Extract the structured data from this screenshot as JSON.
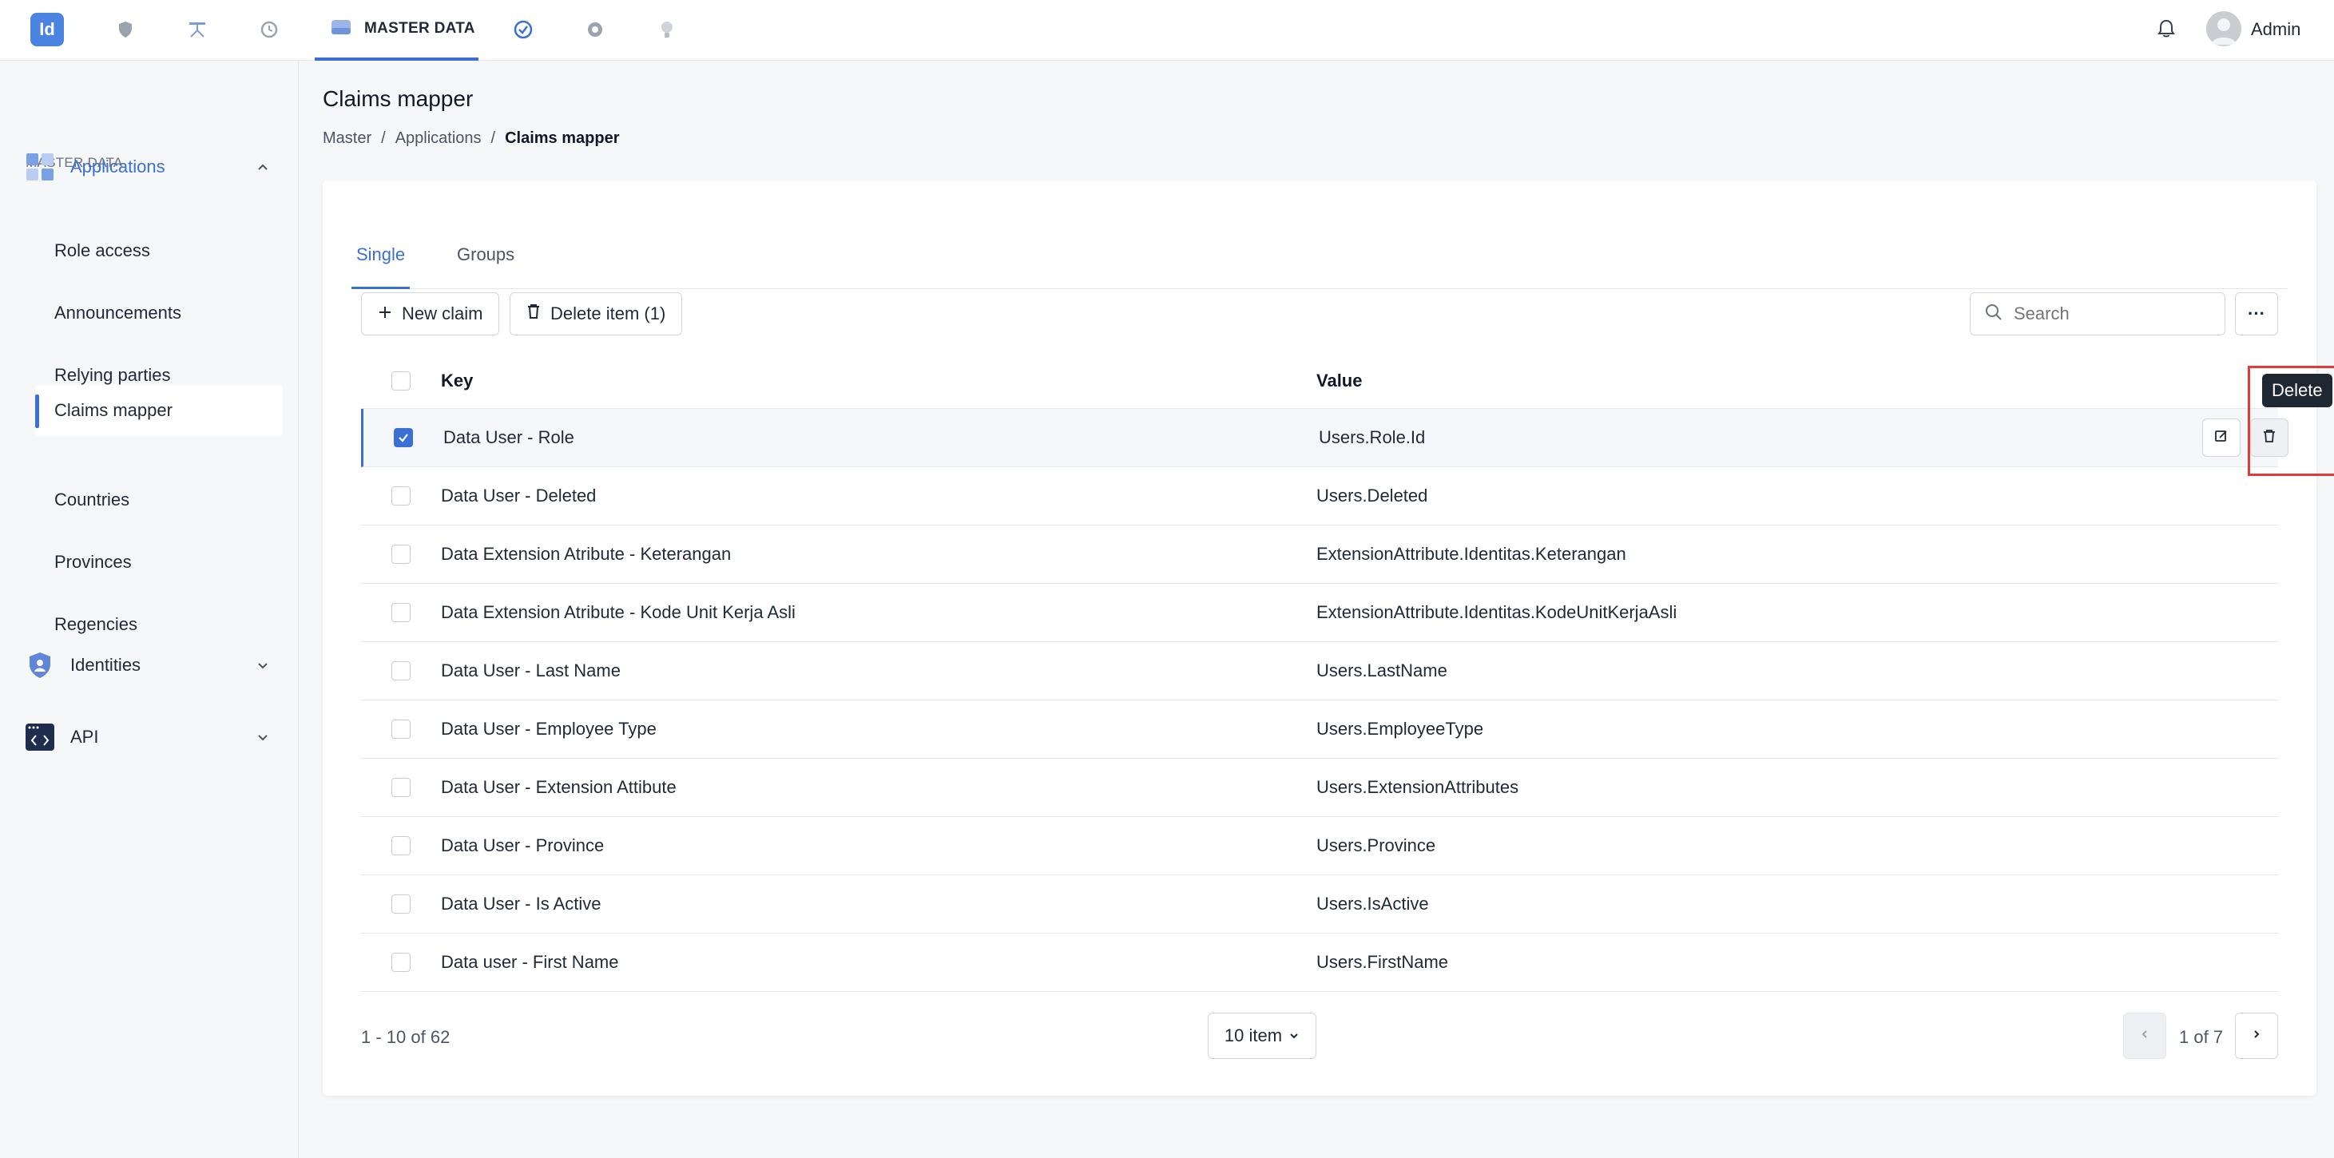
{
  "app": {
    "logo_text": "Id"
  },
  "topnav": {
    "active_label": "MASTER DATA",
    "user_name": "Admin"
  },
  "sidebar": {
    "section_label": "MASTER DATA",
    "groups": [
      {
        "label": "Applications",
        "expanded": true
      },
      {
        "label": "Identities",
        "expanded": false
      },
      {
        "label": "API",
        "expanded": false
      }
    ],
    "items": [
      {
        "label": "Role access"
      },
      {
        "label": "Announcements"
      },
      {
        "label": "Relying parties"
      },
      {
        "label": "Claims mapper",
        "active": true
      },
      {
        "label": "Countries"
      },
      {
        "label": "Provinces"
      },
      {
        "label": "Regencies"
      }
    ]
  },
  "page": {
    "title": "Claims mapper",
    "breadcrumb": [
      "Master",
      "Applications",
      "Claims mapper"
    ],
    "separator": "/"
  },
  "tabs": [
    {
      "label": "Single",
      "active": true
    },
    {
      "label": "Groups",
      "active": false
    }
  ],
  "toolbar": {
    "new_label": "New claim",
    "delete_label": "Delete item (1)",
    "search_placeholder": "Search",
    "more_label": "···"
  },
  "table": {
    "headers": {
      "key": "Key",
      "value": "Value"
    },
    "rows": [
      {
        "key": "Data User - Role",
        "value": "Users.Role.Id",
        "checked": true
      },
      {
        "key": "Data User - Deleted",
        "value": "Users.Deleted",
        "checked": false
      },
      {
        "key": "Data Extension Atribute - Keterangan",
        "value": "ExtensionAttribute.Identitas.Keterangan",
        "checked": false
      },
      {
        "key": "Data Extension Atribute - Kode Unit Kerja Asli",
        "value": "ExtensionAttribute.Identitas.KodeUnitKerjaAsli",
        "checked": false
      },
      {
        "key": "Data User - Last Name",
        "value": "Users.LastName",
        "checked": false
      },
      {
        "key": "Data User - Employee Type",
        "value": "Users.EmployeeType",
        "checked": false
      },
      {
        "key": "Data User - Extension Attibute",
        "value": "Users.ExtensionAttributes",
        "checked": false
      },
      {
        "key": "Data User - Province",
        "value": "Users.Province",
        "checked": false
      },
      {
        "key": "Data User - Is Active",
        "value": "Users.IsActive",
        "checked": false
      },
      {
        "key": "Data user - First Name",
        "value": "Users.FirstName",
        "checked": false
      }
    ],
    "tooltip": "Delete"
  },
  "pagination": {
    "range_text": "1 - 10 of 62",
    "page_size": "10 item",
    "page_info": "1 of 7"
  },
  "colors": {
    "accent": "#3b6fd4",
    "highlight": "#e03b3b"
  }
}
